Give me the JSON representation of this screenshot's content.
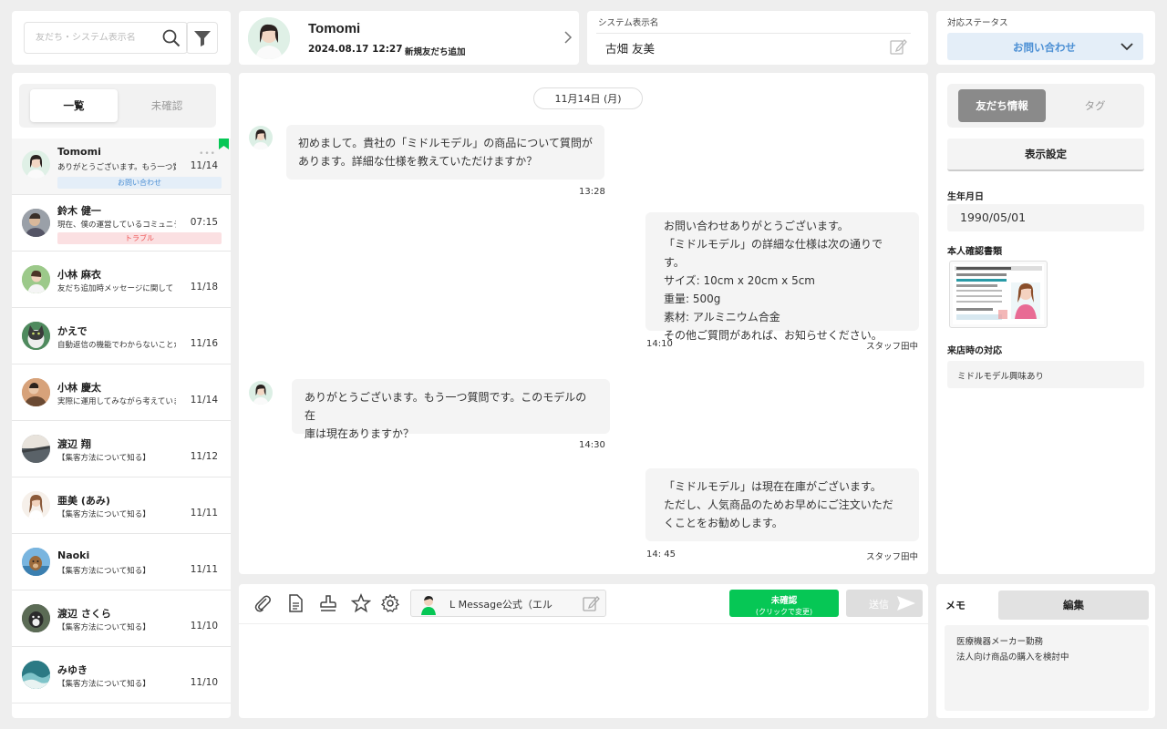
{
  "search": {
    "placeholder": "友だち・システム表示名"
  },
  "header": {
    "name": "Tomomi",
    "datetime": "2024.08.17 12:27",
    "note": "新規友だち追加"
  },
  "system_name": {
    "label": "システム表示名",
    "value": "古畑 友美"
  },
  "status": {
    "label": "対応ステータス",
    "value": "お問い合わせ"
  },
  "list": {
    "tabs": [
      "一覧",
      "未確認"
    ],
    "friends": [
      {
        "name": "Tomomi",
        "preview": "ありがとうございます。もう一つ質問です。",
        "date": "11/14",
        "tag": "お問い合わせ"
      },
      {
        "name": "鈴木 健一",
        "preview": "現在、僕の運営しているコミュニティで",
        "date": "07:15",
        "tag": "トラブル"
      },
      {
        "name": "小林 麻衣",
        "preview": "友だち追加時メッセージに関して",
        "date": "11/18"
      },
      {
        "name": "かえで",
        "preview": "自動返信の機能でわからないことが",
        "date": "11/16"
      },
      {
        "name": "小林 慶太",
        "preview": "実際に運用してみながら考えています",
        "date": "11/14"
      },
      {
        "name": "渡辺 翔",
        "preview": "【集客方法について知る】",
        "date": "11/12"
      },
      {
        "name": "亜美 (あみ)",
        "preview": "【集客方法について知る】",
        "date": "11/11"
      },
      {
        "name": "Naoki",
        "preview": "【集客方法について知る】",
        "date": "11/11"
      },
      {
        "name": "渡辺 さくら",
        "preview": "【集客方法について知る】",
        "date": "11/10"
      },
      {
        "name": "みゆき",
        "preview": "【集客方法について知る】",
        "date": "11/10"
      }
    ]
  },
  "chat": {
    "date_divider": "11月14日 (月)",
    "messages": [
      {
        "side": "left",
        "lines": [
          "初めまして。貴社の「ミドルモデル」の商品について質問が",
          "あります。詳細な仕様を教えていただけますか？"
        ],
        "time": "13:28"
      },
      {
        "side": "right",
        "lines": [
          "お問い合わせありがとうございます。",
          "「ミドルモデル」の詳細な仕様は次の通りです。",
          "サイズ: 10cm x 20cm x 5cm",
          "重量: 500g",
          "素材: アルミニウム合金",
          "その他ご質問があれば、お知らせください。"
        ],
        "time": "14:10",
        "staff": "スタッフ田中"
      },
      {
        "side": "left",
        "lines": [
          "ありがとうございます。もう一つ質問です。このモデルの在",
          "庫は現在ありますか？"
        ],
        "time": "14:30"
      },
      {
        "side": "right",
        "lines": [
          "「ミドルモデル」は現在在庫がございます。",
          "ただし、人気商品のためお早めにご注文いただ",
          "くことをお勧めします。"
        ],
        "time": "14: 45",
        "staff": "スタッフ田中"
      }
    ]
  },
  "composer": {
    "sender": "L Message公式（エル",
    "unread_line1": "未確認",
    "unread_line2": "(クリックで変更)",
    "send_label": "送信"
  },
  "info": {
    "tabs": [
      "友だち情報",
      "タグ"
    ],
    "display_settings": "表示設定",
    "birthday_label": "生年月日",
    "birthday": "1990/05/01",
    "id_doc_label": "本人確認書類",
    "visit_label": "来店時の対応",
    "visit_value": "ミドルモデル興味あり"
  },
  "memo": {
    "label": "メモ",
    "edit": "編集",
    "lines": [
      "医療機器メーカー勤務",
      "法人向け商品の購入を検討中"
    ]
  },
  "colors": {
    "accent_green": "#06c755",
    "status_blue": "#4b8fd4",
    "tag_red": "#e55555"
  }
}
